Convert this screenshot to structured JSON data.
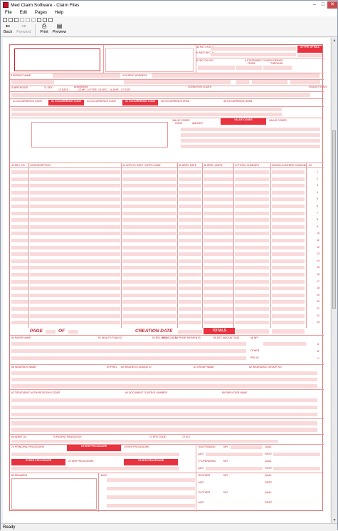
{
  "window": {
    "title": "Med Claim Software - Claim Files"
  },
  "menu": [
    "File",
    "Edit",
    "Pages",
    "Help"
  ],
  "toolbar": {
    "back": "Back",
    "forward": "Forward",
    "print": "Print",
    "preview": "Preview"
  },
  "status": {
    "text": "Ready"
  },
  "form": {
    "labels": {
      "patient_name": "8 PATIENT NAME",
      "patient_address": "9 PATIENT ADDRESS",
      "pat_cntl": "3a PAT CNTL #",
      "med_rec": "b. MED REC. #",
      "type_of_bill": "4 TYPE OF BILL",
      "fed_tax": "5 FED TAX NO",
      "statement_period": "6 STATEMENT COVERS PERIOD",
      "from": "FROM",
      "through": "THROUGH",
      "birthdate": "10 BIRTHDATE",
      "sex": "11 SEX",
      "admission": "ADMISSION",
      "adm_date": "12 DATE",
      "adm_hr": "13 HR",
      "adm_type": "14 TYPE",
      "adm_src": "15 SRC",
      "dhr": "16 DHR",
      "stat": "17 STAT",
      "condition_codes": "CONDITION CODES",
      "acdt_state": "29 ACDT STATE",
      "occ_code": "31 OCCURRENCE CODE",
      "occ_date": "DATE",
      "occ_span": "35 OCCURRENCE SPAN",
      "value_codes": "VALUE CODES",
      "code": "CODE",
      "amount": "AMOUNT",
      "rev_cd": "42 REV. CD.",
      "description": "43 DESCRIPTION",
      "hcpcs": "44 HCPCS / RATE / HIPPS CODE",
      "serv_date": "45 SERV. DATE",
      "serv_units": "46 SERV. UNITS",
      "total_charges": "47 TOTAL CHARGES",
      "non_covered": "48 NON-COVERED CHARGES",
      "col49": "49",
      "page": "PAGE",
      "of": "OF",
      "creation_date": "CREATION DATE",
      "totals": "TOTALS",
      "payer_name": "50 PAYER NAME",
      "health_plan_id": "51 HEALTH PLAN ID",
      "rel_info": "52 REL INFO",
      "asg_ben": "53 ASG BEN",
      "prior_payments": "54 PRIOR PAYMENTS",
      "est_amount_due": "55 EST. AMOUNT DUE",
      "npi": "56 NPI",
      "other": "OTHER",
      "prv_id": "PRV ID",
      "insured_name": "58 INSURED'S NAME",
      "p_rel": "59 P.REL",
      "insured_id": "60 INSURED'S UNIQUE ID",
      "group_name": "61 GROUP NAME",
      "insurance_group_no": "62 INSURANCE GROUP NO.",
      "treatment_auth": "63 TREATMENT AUTHORIZATION CODES",
      "document_control": "64 DOCUMENT CONTROL NUMBER",
      "employer_name": "65 EMPLOYER NAME",
      "admit_dx": "69 ADMIT DX",
      "patient_reason_dx": "70 PATIENT REASON DX",
      "pps_code": "71 PPS CODE",
      "eci": "72 ECI",
      "principal_procedure": "74 PRINCIPAL PROCEDURE",
      "other_procedure": "OTHER PROCEDURE",
      "attending": "76 ATTENDING",
      "operating": "77 OPERATING",
      "other_78": "78 OTHER",
      "other_79": "79 OTHER",
      "npi_short": "NPI",
      "qual": "QUAL",
      "last": "LAST",
      "first": "FIRST",
      "remarks": "80 REMARKS",
      "cc_81": "81CC"
    },
    "row_numbers": [
      "1",
      "2",
      "3",
      "4",
      "5",
      "6",
      "7",
      "8",
      "9",
      "10",
      "11",
      "12",
      "13",
      "14",
      "15",
      "16",
      "17",
      "18",
      "19",
      "20",
      "21",
      "22",
      "23"
    ],
    "payer_rows": [
      "A",
      "B",
      "C"
    ]
  }
}
